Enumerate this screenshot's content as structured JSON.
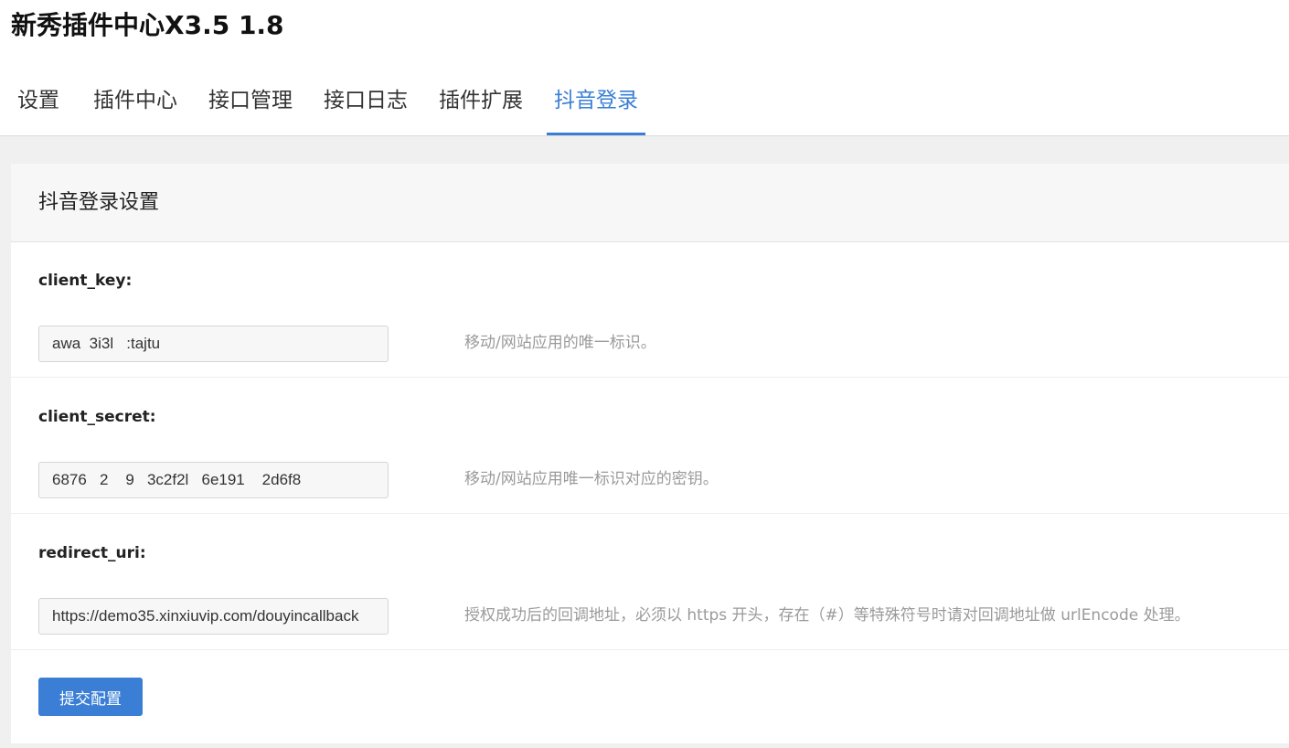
{
  "app": {
    "title": "新秀插件中心X3.5 1.8"
  },
  "tabs": [
    {
      "label": "设置",
      "active": false
    },
    {
      "label": "插件中心",
      "active": false
    },
    {
      "label": "接口管理",
      "active": false
    },
    {
      "label": "接口日志",
      "active": false
    },
    {
      "label": "插件扩展",
      "active": false
    },
    {
      "label": "抖音登录",
      "active": true
    }
  ],
  "panel": {
    "title": "抖音登录设置"
  },
  "fields": [
    {
      "label": "client_key:",
      "value": "awa  3i3l   :tajtu",
      "help": "移动/网站应用的唯一标识。"
    },
    {
      "label": "client_secret:",
      "value": "6876   2    9   3c2f2l   6e191    2d6f8",
      "help": "移动/网站应用唯一标识对应的密钥。"
    },
    {
      "label": "redirect_uri:",
      "value": "https://demo35.xinxiuvip.com/douyincallback",
      "help": "授权成功后的回调地址，必须以 https 开头，存在（#）等特殊符号时请对回调地址做 urlEncode 处理。"
    }
  ],
  "actions": {
    "submit_label": "提交配置"
  },
  "colors": {
    "accent": "#3a7fd5",
    "workspace_bg": "#f0f0f0",
    "panel_head_bg": "#f7f7f7",
    "help_text": "#9a9a9a"
  }
}
